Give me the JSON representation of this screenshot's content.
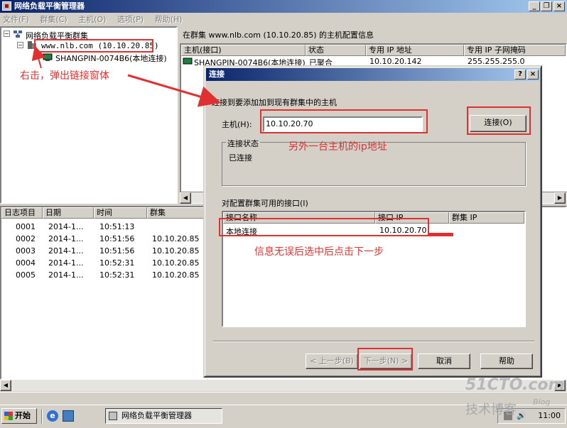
{
  "window": {
    "title": "网络负载平衡管理器",
    "minimize": "_",
    "restore": "❐",
    "close": "×"
  },
  "menu": [
    "文件(F)",
    "群集(C)",
    "主机(O)",
    "选项(P)",
    "帮助(H)"
  ],
  "tree": {
    "root": "网络负载平衡群集",
    "cluster": "www.nlb.com (10.10.20.85)",
    "host": "SHANGPIN-0074B6(本地连接)"
  },
  "host_panel": {
    "title": "在群集 www.nlb.com (10.10.20.85) 的主机配置信息",
    "columns": [
      "主机(接口)",
      "状态",
      "专用 IP 地址",
      "专用 IP 子网掩码"
    ],
    "rows": [
      [
        "SHANGPIN-0074B6(本地连接)",
        "已聚合",
        "10.10.20.142",
        "255.255.255.0"
      ]
    ]
  },
  "log": {
    "columns": [
      "日志项目",
      "日期",
      "时间",
      "群集"
    ],
    "rows": [
      [
        "0001",
        "2014-1...",
        "10:51:13",
        ""
      ],
      [
        "0002",
        "2014-1...",
        "10:51:56",
        "10.10.20.85"
      ],
      [
        "0003",
        "2014-1...",
        "10:51:56",
        "10.10.20.85"
      ],
      [
        "0004",
        "2014-1...",
        "10:52:31",
        "10.10.20.85"
      ],
      [
        "0005",
        "2014-1...",
        "10:52:31",
        "10.10.20.85"
      ]
    ]
  },
  "dialog": {
    "title": "连接",
    "help_btn": "?",
    "close_btn": "×",
    "instruction": "连接到要添加加到现有群集中的主机",
    "host_label": "主机(H):",
    "host_value": "10.10.20.70",
    "connect_btn": "连接(O)",
    "status_group": "连接状态",
    "status_value": "已连接",
    "interfaces_label": "对配置群集可用的接口(I)",
    "interface_columns": [
      "接口名称",
      "接口 IP",
      "群集 IP"
    ],
    "interfaces": [
      [
        "本地连接",
        "10.10.20.70",
        ""
      ]
    ],
    "back_btn": "< 上一步(B)",
    "next_btn": "下一步(N) >",
    "cancel_btn": "取消",
    "help_button": "帮助"
  },
  "annotations": {
    "right_click": "右击，弹出链接窗体",
    "ip_hint": "另外一台主机的ip地址",
    "next_hint": "信息无误后选中后点击下一步"
  },
  "taskbar": {
    "start": "开始",
    "task": "网络负载平衡管理器",
    "clock": "11:00"
  },
  "watermark": {
    "line1": "51CTO.com",
    "line2": "技术博客",
    "line3": "Blog"
  },
  "colors": {
    "title_start": "#0a246a",
    "title_end": "#a6caf0",
    "annotation": "#e03030"
  }
}
